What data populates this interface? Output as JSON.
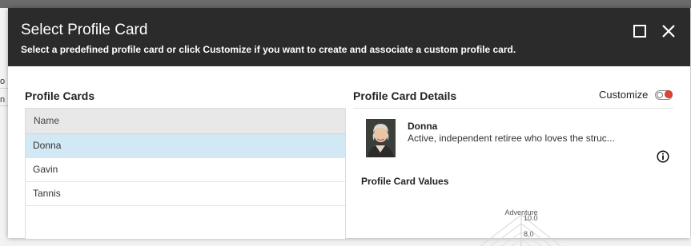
{
  "dialog": {
    "title": "Select Profile Card",
    "subtitle": "Select a predefined profile card or click Customize if you want to create and associate a custom profile card."
  },
  "profile_cards": {
    "heading": "Profile Cards",
    "column_header": "Name",
    "rows": [
      {
        "name": "Donna",
        "selected": true
      },
      {
        "name": "Gavin",
        "selected": false
      },
      {
        "name": "Tannis",
        "selected": false
      }
    ]
  },
  "details": {
    "heading": "Profile Card Details",
    "customize_label": "Customize",
    "customize_enabled": true,
    "name": "Donna",
    "description": "Active, independent retiree who loves the struc...",
    "values_heading": "Profile Card Values",
    "radar": {
      "axis_label": "Adventure",
      "ticks": [
        "10.0",
        "8.0"
      ]
    }
  },
  "background": {
    "fragments": [
      "o D",
      "n"
    ]
  },
  "colors": {
    "header_bg": "#2b2b2b",
    "selected_row": "#d2e8f4",
    "toggle_on": "#e34234"
  },
  "icons": [
    "maximize-icon",
    "close-icon",
    "info-icon",
    "toggle-switch"
  ]
}
